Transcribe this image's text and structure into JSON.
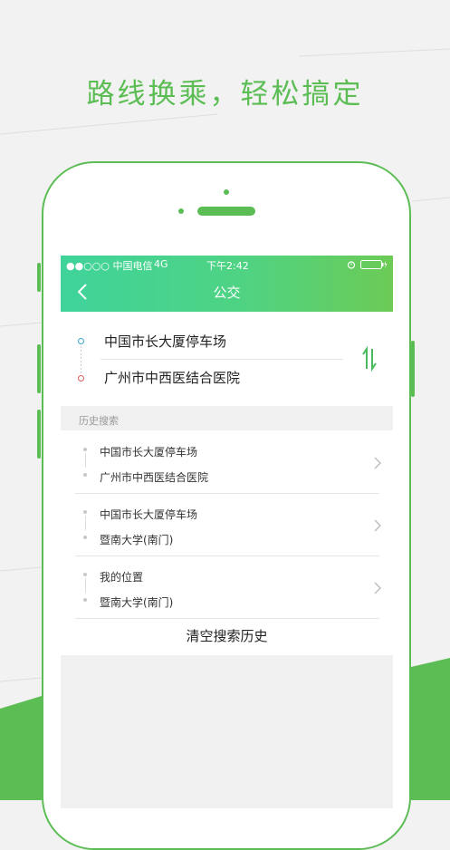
{
  "headline": "路线换乘，轻松搞定",
  "status_bar": {
    "carrier": "●●○○○ 中国电信",
    "network": "4G",
    "time": "下午2:42"
  },
  "nav": {
    "title": "公交"
  },
  "route": {
    "origin": "中国市长大厦停车场",
    "destination": "广州市中西医结合医院"
  },
  "history_label": "历史搜索",
  "history": [
    {
      "from": "中国市长大厦停车场",
      "to": "广州市中西医结合医院"
    },
    {
      "from": "中国市长大厦停车场",
      "to": "暨南大学(南门)"
    },
    {
      "from": "我的位置",
      "to": "暨南大学(南门)"
    }
  ],
  "clear_history": "清空搜索历史",
  "colors": {
    "brand_green": "#5bbd54",
    "gradient_start": "#3fd39a",
    "gradient_end": "#6ccb55"
  }
}
